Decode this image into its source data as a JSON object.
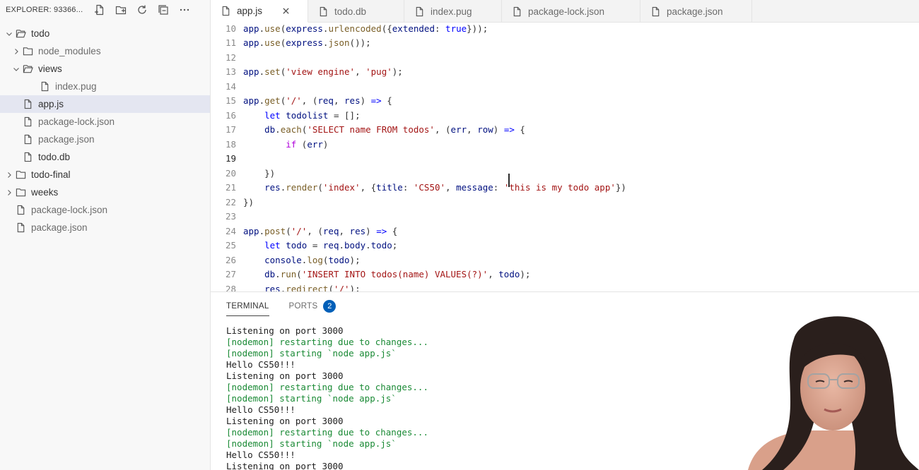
{
  "explorer": {
    "title": "EXPLORER: 93366...",
    "actions": [
      {
        "name": "new-file-icon"
      },
      {
        "name": "new-folder-icon"
      },
      {
        "name": "refresh-icon"
      },
      {
        "name": "collapse-all-icon"
      },
      {
        "name": "more-icon"
      }
    ]
  },
  "tree": [
    {
      "label": "todo",
      "type": "folder",
      "expanded": true,
      "depth": 0
    },
    {
      "label": "node_modules",
      "type": "folder",
      "expanded": false,
      "depth": 1,
      "muted": true
    },
    {
      "label": "views",
      "type": "folder",
      "expanded": true,
      "depth": 1
    },
    {
      "label": "index.pug",
      "type": "file",
      "depth": 2,
      "muted": true
    },
    {
      "label": "app.js",
      "type": "file",
      "depth": 1,
      "selected": true
    },
    {
      "label": "package-lock.json",
      "type": "file",
      "depth": 1,
      "muted": true
    },
    {
      "label": "package.json",
      "type": "file",
      "depth": 1,
      "muted": true
    },
    {
      "label": "todo.db",
      "type": "file",
      "depth": 1
    },
    {
      "label": "todo-final",
      "type": "folder",
      "expanded": false,
      "depth": 0
    },
    {
      "label": "weeks",
      "type": "folder",
      "expanded": false,
      "depth": 0
    },
    {
      "label": "package-lock.json",
      "type": "file",
      "depth": 0,
      "muted": true
    },
    {
      "label": "package.json",
      "type": "file",
      "depth": 0,
      "muted": true
    }
  ],
  "tabs": [
    {
      "label": "app.js",
      "active": true
    },
    {
      "label": "todo.db",
      "active": false
    },
    {
      "label": "index.pug",
      "active": false
    },
    {
      "label": "package-lock.json",
      "active": false
    },
    {
      "label": "package.json",
      "active": false
    }
  ],
  "editor": {
    "current_line": 19,
    "lines": [
      {
        "n": "10",
        "tokens": [
          [
            "vr",
            "app"
          ],
          [
            "",
            "."
          ],
          [
            "fn",
            "use"
          ],
          [
            "",
            "("
          ],
          [
            "vr",
            "express"
          ],
          [
            "",
            "."
          ],
          [
            "fn",
            "urlencoded"
          ],
          [
            "",
            "({"
          ],
          [
            "vr",
            "extended"
          ],
          [
            "",
            ": "
          ],
          [
            "k",
            "true"
          ],
          [
            "",
            "}));"
          ]
        ]
      },
      {
        "n": "11",
        "tokens": [
          [
            "vr",
            "app"
          ],
          [
            "",
            "."
          ],
          [
            "fn",
            "use"
          ],
          [
            "",
            "("
          ],
          [
            "vr",
            "express"
          ],
          [
            "",
            "."
          ],
          [
            "fn",
            "json"
          ],
          [
            "",
            "());"
          ]
        ]
      },
      {
        "n": "12",
        "tokens": []
      },
      {
        "n": "13",
        "tokens": [
          [
            "vr",
            "app"
          ],
          [
            "",
            "."
          ],
          [
            "fn",
            "set"
          ],
          [
            "",
            "("
          ],
          [
            "s",
            "'view engine'"
          ],
          [
            "",
            ", "
          ],
          [
            "s",
            "'pug'"
          ],
          [
            "",
            ");"
          ]
        ]
      },
      {
        "n": "14",
        "tokens": []
      },
      {
        "n": "15",
        "tokens": [
          [
            "vr",
            "app"
          ],
          [
            "",
            "."
          ],
          [
            "fn",
            "get"
          ],
          [
            "",
            "("
          ],
          [
            "s",
            "'/'"
          ],
          [
            "",
            ", ("
          ],
          [
            "vr",
            "req"
          ],
          [
            "",
            ", "
          ],
          [
            "vr",
            "res"
          ],
          [
            "",
            ") "
          ],
          [
            "k",
            "=>"
          ],
          [
            "",
            " {"
          ]
        ]
      },
      {
        "n": "16",
        "tokens": [
          [
            "",
            "    "
          ],
          [
            "k",
            "let"
          ],
          [
            "",
            " "
          ],
          [
            "vr",
            "todolist"
          ],
          [
            "",
            " = [];"
          ]
        ]
      },
      {
        "n": "17",
        "tokens": [
          [
            "",
            "    "
          ],
          [
            "vr",
            "db"
          ],
          [
            "",
            "."
          ],
          [
            "fn",
            "each"
          ],
          [
            "",
            "("
          ],
          [
            "s",
            "'SELECT name FROM todos'"
          ],
          [
            "",
            ", ("
          ],
          [
            "vr",
            "err"
          ],
          [
            "",
            ", "
          ],
          [
            "vr",
            "row"
          ],
          [
            "",
            ") "
          ],
          [
            "k",
            "=>"
          ],
          [
            "",
            " {"
          ]
        ]
      },
      {
        "n": "18",
        "tokens": [
          [
            "",
            "        "
          ],
          [
            "kw",
            "if"
          ],
          [
            "",
            " ("
          ],
          [
            "vr",
            "err"
          ],
          [
            "",
            ")"
          ]
        ]
      },
      {
        "n": "19",
        "tokens": []
      },
      {
        "n": "20",
        "tokens": [
          [
            "",
            "    })"
          ]
        ]
      },
      {
        "n": "21",
        "tokens": [
          [
            "",
            "    "
          ],
          [
            "vr",
            "res"
          ],
          [
            "",
            "."
          ],
          [
            "fn",
            "render"
          ],
          [
            "",
            "("
          ],
          [
            "s",
            "'index'"
          ],
          [
            "",
            ", {"
          ],
          [
            "vr",
            "title"
          ],
          [
            "",
            ": "
          ],
          [
            "s",
            "'CS50'"
          ],
          [
            "",
            ", "
          ],
          [
            "vr",
            "message"
          ],
          [
            "",
            ": "
          ],
          [
            "s",
            "'this is my todo app'"
          ],
          [
            "",
            "})"
          ]
        ]
      },
      {
        "n": "22",
        "tokens": [
          [
            "",
            "})"
          ]
        ]
      },
      {
        "n": "23",
        "tokens": []
      },
      {
        "n": "24",
        "tokens": [
          [
            "vr",
            "app"
          ],
          [
            "",
            "."
          ],
          [
            "fn",
            "post"
          ],
          [
            "",
            "("
          ],
          [
            "s",
            "'/'"
          ],
          [
            "",
            ", ("
          ],
          [
            "vr",
            "req"
          ],
          [
            "",
            ", "
          ],
          [
            "vr",
            "res"
          ],
          [
            "",
            ") "
          ],
          [
            "k",
            "=>"
          ],
          [
            "",
            " {"
          ]
        ]
      },
      {
        "n": "25",
        "tokens": [
          [
            "",
            "    "
          ],
          [
            "k",
            "let"
          ],
          [
            "",
            " "
          ],
          [
            "vr",
            "todo"
          ],
          [
            "",
            " = "
          ],
          [
            "vr",
            "req"
          ],
          [
            "",
            "."
          ],
          [
            "vr",
            "body"
          ],
          [
            "",
            "."
          ],
          [
            "vr",
            "todo"
          ],
          [
            "",
            ";"
          ]
        ]
      },
      {
        "n": "26",
        "tokens": [
          [
            "",
            "    "
          ],
          [
            "vr",
            "console"
          ],
          [
            "",
            "."
          ],
          [
            "fn",
            "log"
          ],
          [
            "",
            "("
          ],
          [
            "vr",
            "todo"
          ],
          [
            "",
            ");"
          ]
        ]
      },
      {
        "n": "27",
        "tokens": [
          [
            "",
            "    "
          ],
          [
            "vr",
            "db"
          ],
          [
            "",
            "."
          ],
          [
            "fn",
            "run"
          ],
          [
            "",
            "("
          ],
          [
            "s",
            "'INSERT INTO todos(name) VALUES(?)'"
          ],
          [
            "",
            ", "
          ],
          [
            "vr",
            "todo"
          ],
          [
            "",
            ");"
          ]
        ]
      },
      {
        "n": "28",
        "tokens": [
          [
            "",
            "    "
          ],
          [
            "vr",
            "res"
          ],
          [
            "",
            "."
          ],
          [
            "fn",
            "redirect"
          ],
          [
            "",
            "("
          ],
          [
            "s",
            "'/'"
          ],
          [
            "",
            ");"
          ]
        ]
      }
    ]
  },
  "panel": {
    "tabs": [
      {
        "label": "TERMINAL",
        "active": true
      },
      {
        "label": "PORTS",
        "active": false,
        "badge": "2"
      }
    ],
    "terminal_lines": [
      {
        "text": "Listening on port 3000",
        "color": "default"
      },
      {
        "text": "[nodemon] restarting due to changes...",
        "color": "green"
      },
      {
        "text": "[nodemon] starting `node app.js`",
        "color": "green"
      },
      {
        "text": "Hello CS50!!!",
        "color": "default"
      },
      {
        "text": "Listening on port 3000",
        "color": "default"
      },
      {
        "text": "[nodemon] restarting due to changes...",
        "color": "green"
      },
      {
        "text": "[nodemon] starting `node app.js`",
        "color": "green"
      },
      {
        "text": "Hello CS50!!!",
        "color": "default"
      },
      {
        "text": "Listening on port 3000",
        "color": "default"
      },
      {
        "text": "[nodemon] restarting due to changes...",
        "color": "green"
      },
      {
        "text": "[nodemon] starting `node app.js`",
        "color": "green"
      },
      {
        "text": "Hello CS50!!!",
        "color": "default"
      },
      {
        "text": "Listening on port 3000",
        "color": "default"
      }
    ]
  },
  "colors": {
    "accent": "#005fb8",
    "selection": "#e4e6f1",
    "terminal_green": "#1a8a35"
  }
}
